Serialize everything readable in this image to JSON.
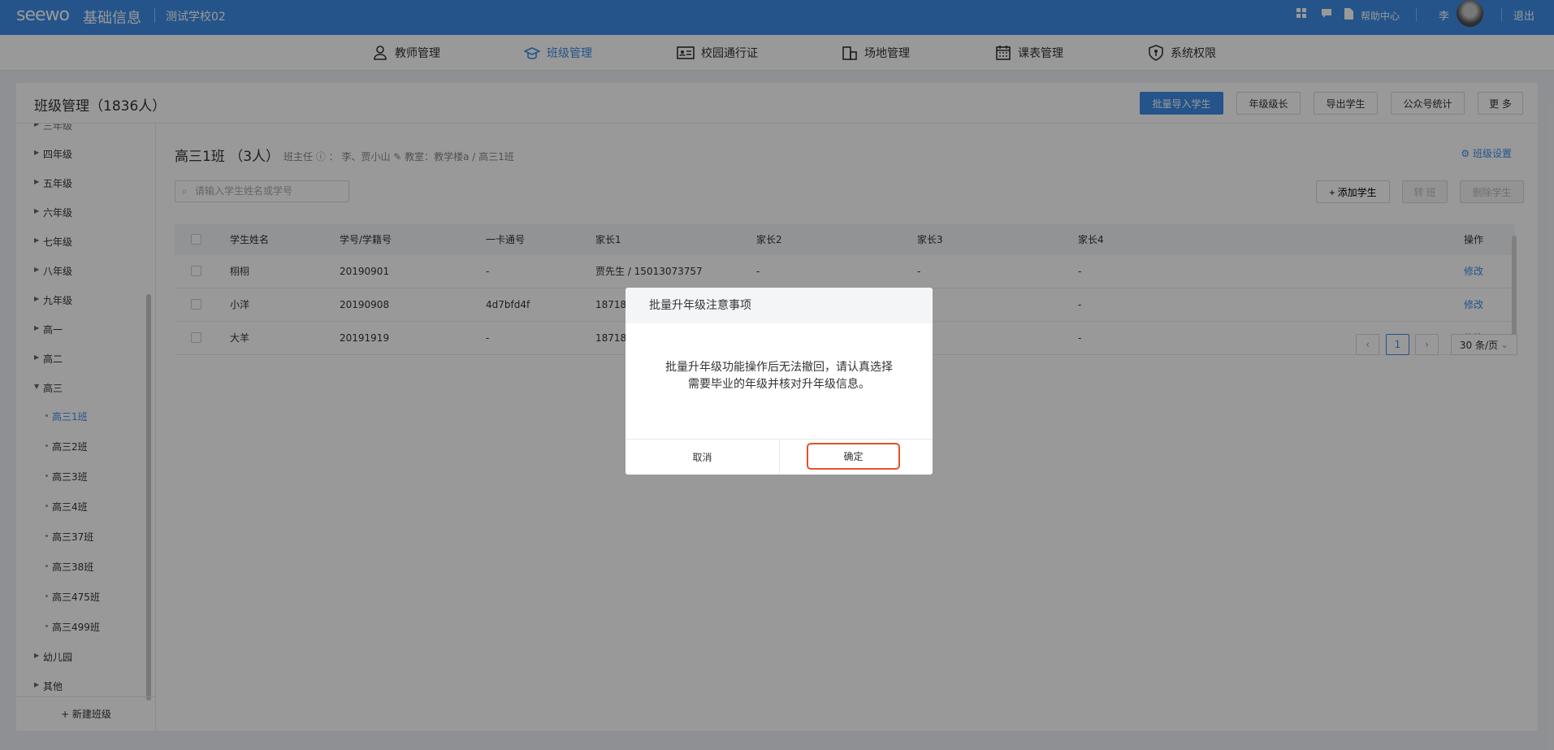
{
  "topbar": {
    "brand": "seewo",
    "brand_sub": "基础信息",
    "school": "测试学校02",
    "help": "帮助中心",
    "user": "李",
    "logout": "退出"
  },
  "nav": {
    "items": [
      {
        "label": "教师管理",
        "icon": "person-icon"
      },
      {
        "label": "班级管理",
        "icon": "graduation-cap-icon",
        "active": true
      },
      {
        "label": "校园通行证",
        "icon": "id-card-icon"
      },
      {
        "label": "场地管理",
        "icon": "venue-icon"
      },
      {
        "label": "课表管理",
        "icon": "calendar-icon"
      },
      {
        "label": "系统权限",
        "icon": "shield-icon"
      }
    ]
  },
  "panel": {
    "title": "班级管理（1836人）",
    "buttons": {
      "import": "批量导入学生",
      "grade_head": "年级级长",
      "export": "导出学生",
      "stats": "公众号统计",
      "more": "更 多"
    }
  },
  "sidebar": {
    "partial": "三年级",
    "grades": [
      "四年级",
      "五年级",
      "六年级",
      "七年级",
      "八年级",
      "九年级",
      "高一",
      "高二",
      "高三"
    ],
    "classes": [
      "高三1班",
      "高三2班",
      "高三3班",
      "高三4班",
      "高三37班",
      "高三38班",
      "高三475班",
      "高三499班"
    ],
    "tail": [
      "幼儿园",
      "其他"
    ],
    "new_class": "+ 新建班级"
  },
  "content": {
    "class_title": "高三1班 （3人）",
    "meta": "班主任 ⓘ ：  李、贾小山  ✎     教室：教学楼a / 高三1班",
    "settings": "班级设置",
    "search_placeholder": "请输入学生姓名或学号",
    "add_student": "+ 添加学生",
    "transfer": "转 班",
    "delete_student": "删除学生",
    "columns": [
      "学生姓名",
      "学号/学籍号",
      "一卡通号",
      "家长1",
      "家长2",
      "家长3",
      "家长4",
      "操作"
    ],
    "rows": [
      [
        "栩栩",
        "20190901",
        "-",
        "贾先生 / 15013073757",
        "-",
        "-",
        "-",
        "修改"
      ],
      [
        "小洋",
        "20190908",
        "4d7bfd4f",
        "18718",
        "",
        "",
        "-",
        "修改"
      ],
      [
        "大羊",
        "20191919",
        "-",
        "18718",
        "",
        "",
        "-",
        "修改"
      ]
    ],
    "page": "1",
    "page_size": "30 条/页"
  },
  "modal": {
    "title": "批量升年级注意事项",
    "line1": "批量升年级功能操作后无法撤回，请认真选择",
    "line2": "需要毕业的年级并核对升年级信息。",
    "cancel": "取消",
    "ok": "确定"
  },
  "colors": {
    "accent": "#3c8de6",
    "highlight": "#e5502e"
  }
}
